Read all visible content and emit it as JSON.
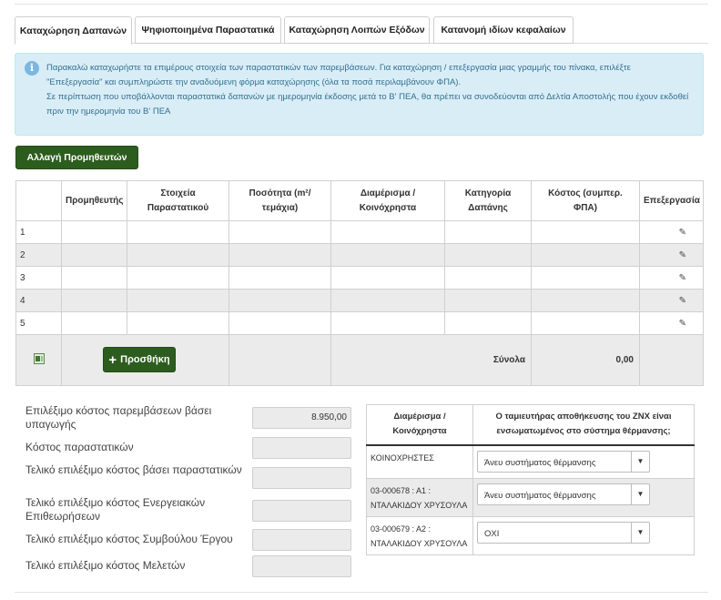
{
  "tabs": [
    {
      "label": "Καταχώρηση Δαπανών"
    },
    {
      "label": "Ψηφιοποιημένα Παραστατικά"
    },
    {
      "label": "Καταχώρηση Λοιπών Εξόδων"
    },
    {
      "label": "Κατανομή ιδίων κεφαλαίων"
    }
  ],
  "info": {
    "line1": "Παρακαλώ καταχωρήστε τα επιμέρους στοιχεία των παραστατικών των παρεμβάσεων. Για καταχώρηση / επεξεργασία μιας γραμμής του πίνακα, επιλέξτε",
    "line2": "\"Επεξεργασία\" και συμπληρώστε την αναδυόμενη φόρμα καταχώρησης (όλα τα ποσά περιλαμβάνουν ΦΠΑ).",
    "line3": "Σε περίπτωση που υποβάλλονται παραστατικά δαπανών με ημερομηνία έκδοσης μετά το Β' ΠΕΑ, θα πρέπει να συνοδεύονται από Δελτία Αποστολής που έχουν εκδοθεί",
    "line4": "πριν την ημερομηνία του Β' ΠΕΑ"
  },
  "change_suppliers_label": "Αλλαγή Προμηθευτών",
  "grid": {
    "headers": {
      "supplier": "Προμηθευτής",
      "doc_line1": "Στοιχεία",
      "doc_line2": "Παραστατικού",
      "qty_line1": "Ποσότητα (m²/",
      "qty_line2": "τεμάχια)",
      "apt_line1": "Διαμέρισμα /",
      "apt_line2": "Κοινόχρηστα",
      "cat_line1": "Κατηγορία",
      "cat_line2": "Δαπάνης",
      "cost_line1": "Κόστος (συμπερ.",
      "cost_line2": "ΦΠΑ)",
      "edit": "Επεξεργασία"
    },
    "rows": [
      "1",
      "2",
      "3",
      "4",
      "5"
    ],
    "add_label": "Προσθήκη",
    "totals_label": "Σύνολα",
    "totals_value": "0,00"
  },
  "costs": {
    "eligible_by_productivity": {
      "label": "Επιλέξιμο κόστος παρεμβάσεων βάσει υπαγωγής",
      "value": "8.950,00"
    },
    "documents": {
      "label": "Κόστος παραστατικών",
      "value": ""
    },
    "final_by_documents": {
      "label": "Τελικό επιλέξιμο κόστος βάσει παραστατικών",
      "value": ""
    },
    "final_energy": {
      "label": "Τελικό επιλέξιμο κόστος Ενεργειακών Επιθεωρήσεων",
      "value": ""
    },
    "final_consultant": {
      "label": "Τελικό επιλέξιμο κόστος Συμβούλου Έργου",
      "value": ""
    },
    "final_studies": {
      "label": "Τελικό επιλέξιμο κόστος Μελετών",
      "value": ""
    }
  },
  "heating": {
    "col1_line1": "Διαμέρισμα /",
    "col1_line2": "Κοινόχρηστα",
    "col2_line1": "Ο ταμιευτήρας αποθήκευσης του ΖΝΧ είναι",
    "col2_line2": "ενσωματωμένος στο σύστημα θέρμανσης;",
    "rows": [
      {
        "unit_line1": "ΚΟΙΝΟΧΡΗΣΤΕΣ",
        "unit_line2": "",
        "value": "Άνευ συστήματος θέρμανσης"
      },
      {
        "unit_line1": "03-000678 : Α1 :",
        "unit_line2": "ΝΤΑΛΑΚΙΔΟΥ ΧΡΥΣΟΥΛΑ",
        "value": "Άνευ συστήματος θέρμανσης"
      },
      {
        "unit_line1": "03-000679 : Α2 :",
        "unit_line2": "ΝΤΑΛΑΚΙΔΟΥ ΧΡΥΣΟΥΛΑ",
        "value": "ΟΧΙ"
      }
    ]
  }
}
